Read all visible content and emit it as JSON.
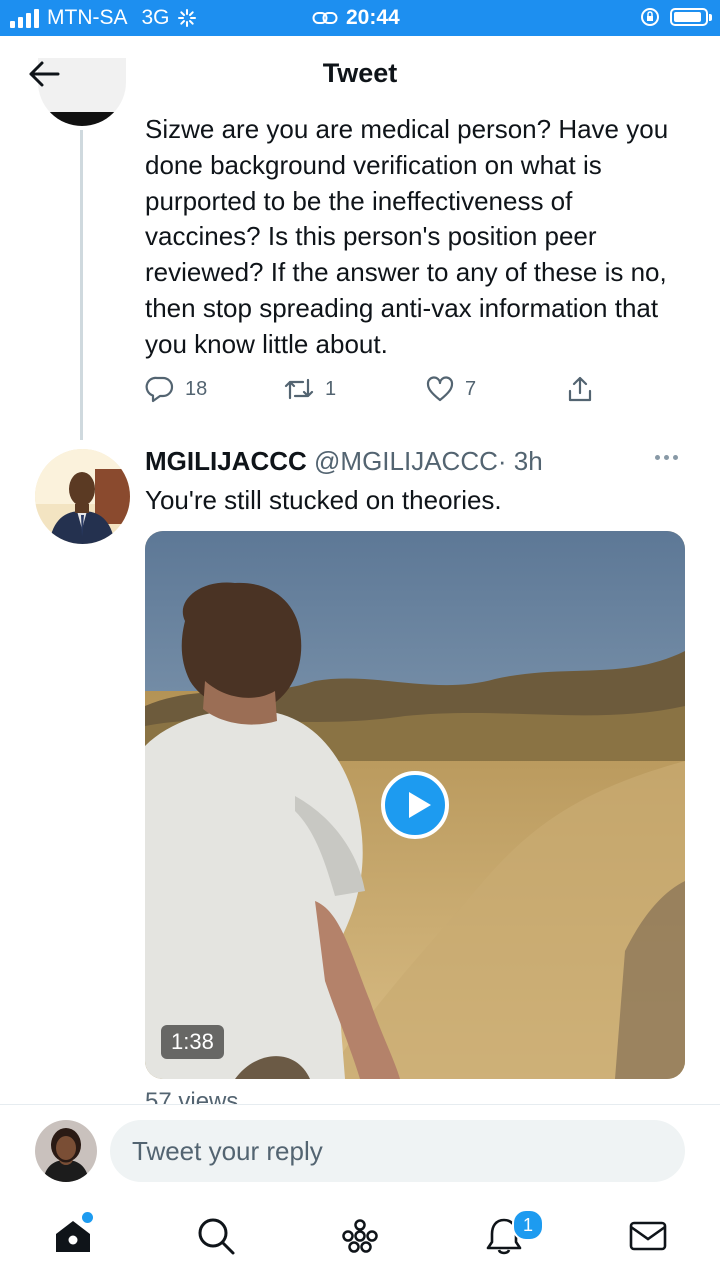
{
  "status_bar": {
    "carrier": "MTN-SA",
    "network": "3G",
    "time": "20:44",
    "signal_bars": 4
  },
  "header": {
    "title": "Tweet"
  },
  "parent_tweet": {
    "text": "Sizwe are you are medical person? Have you done background verification on what is purported to be the ineffectiveness of vaccines? Is this person's position peer reviewed? If the answer to any of these is no, then stop spreading anti-vax information that you know little about.",
    "replies": "18",
    "retweets": "1",
    "likes": "7"
  },
  "reply_tweet": {
    "name": "MGILIJACCC",
    "handle": "@MGILIJACCC",
    "time": "· 3h",
    "text": "You're still stucked on theories.",
    "video_duration": "1:38",
    "views": "57 views"
  },
  "reply_box": {
    "placeholder": "Tweet your reply"
  },
  "tab_bar": {
    "tabs": [
      "home-icon",
      "search-icon",
      "spaces-icon",
      "bell-icon",
      "mail-icon"
    ],
    "notifications_badge": "1"
  },
  "colors": {
    "accent": "#1d9bf0",
    "status_bar": "#1d8ff0",
    "secondary_text": "#536471"
  }
}
